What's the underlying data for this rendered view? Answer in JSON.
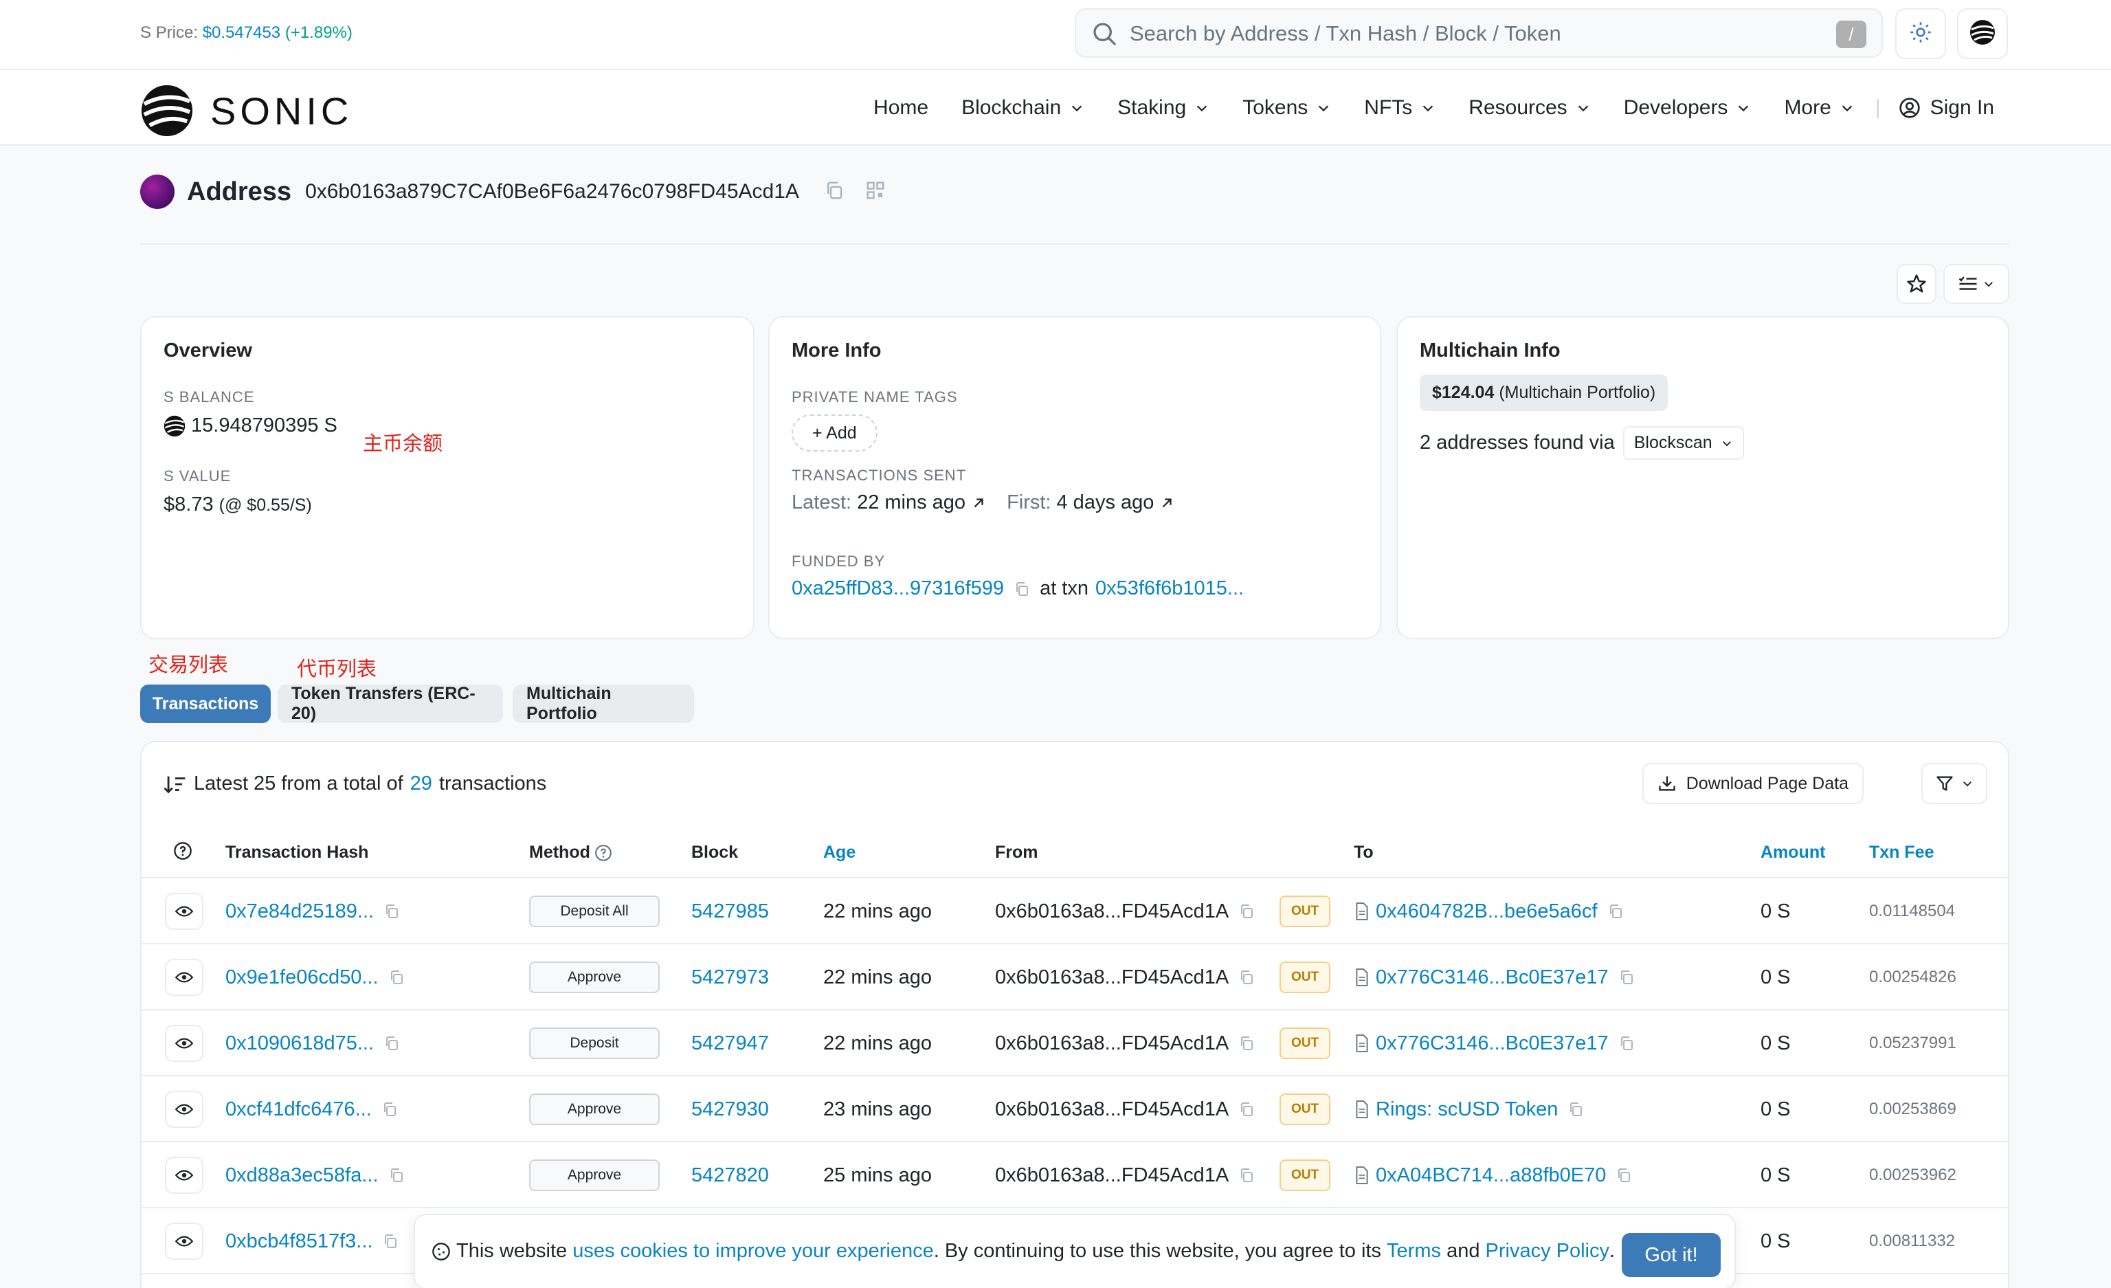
{
  "topbar": {
    "price_label": "S Price:",
    "price_value": "$0.547453",
    "price_change": "(+1.89%)",
    "search_placeholder": "Search by Address / Txn Hash / Block / Token",
    "search_shortcut": "/"
  },
  "nav": {
    "logo_text": "SONIC",
    "items": [
      "Home",
      "Blockchain",
      "Staking",
      "Tokens",
      "NFTs",
      "Resources",
      "Developers",
      "More"
    ],
    "sign_in": "Sign In"
  },
  "header": {
    "title": "Address",
    "address": "0x6b0163a879C7CAf0Be6F6a2476c0798FD45Acd1A"
  },
  "overview": {
    "title": "Overview",
    "balance_label": "S BALANCE",
    "balance_value": "15.948790395 S",
    "value_label": "S VALUE",
    "value_amount": "$8.73",
    "value_rate": "(@ $0.55/S)",
    "annotation": "主币余额"
  },
  "more_info": {
    "title": "More Info",
    "tags_label": "PRIVATE NAME TAGS",
    "add_label": "+ Add",
    "sent_label": "TRANSACTIONS SENT",
    "latest_label": "Latest:",
    "latest_value": "22 mins ago",
    "first_label": "First:",
    "first_value": "4 days ago",
    "funded_label": "FUNDED BY",
    "funded_address": "0xa25ffD83...97316f599",
    "at_txn": "at txn",
    "funded_txn": "0x53f6f6b1015..."
  },
  "multichain": {
    "title": "Multichain Info",
    "portfolio_value": "$124.04",
    "portfolio_label": "(Multichain Portfolio)",
    "found_text": "2 addresses found via",
    "found_source": "Blockscan"
  },
  "annotations": {
    "tx_list": "交易列表",
    "token_list": "代币列表"
  },
  "tabs": [
    "Transactions",
    "Token Transfers (ERC-20)",
    "Multichain Portfolio"
  ],
  "tx": {
    "summary_pre": "Latest 25 from a total of",
    "summary_count": "29",
    "summary_post": "transactions",
    "download": "Download Page Data",
    "columns": [
      "Transaction Hash",
      "Method",
      "Block",
      "Age",
      "From",
      "To",
      "Amount",
      "Txn Fee"
    ],
    "rows": [
      {
        "hash": "0x7e84d25189...",
        "method": "Deposit All",
        "block": "5427985",
        "age": "22 mins ago",
        "from": "0x6b0163a8...FD45Acd1A",
        "dir": "OUT",
        "to": "0x4604782B...be6e5a6cf",
        "amount": "0 S",
        "fee": "0.01148504"
      },
      {
        "hash": "0x9e1fe06cd50...",
        "method": "Approve",
        "block": "5427973",
        "age": "22 mins ago",
        "from": "0x6b0163a8...FD45Acd1A",
        "dir": "OUT",
        "to": "0x776C3146...Bc0E37e17",
        "amount": "0 S",
        "fee": "0.00254826"
      },
      {
        "hash": "0x1090618d75...",
        "method": "Deposit",
        "block": "5427947",
        "age": "22 mins ago",
        "from": "0x6b0163a8...FD45Acd1A",
        "dir": "OUT",
        "to": "0x776C3146...Bc0E37e17",
        "amount": "0 S",
        "fee": "0.05237991"
      },
      {
        "hash": "0xcf41dfc6476...",
        "method": "Approve",
        "block": "5427930",
        "age": "23 mins ago",
        "from": "0x6b0163a8...FD45Acd1A",
        "dir": "OUT",
        "to": "Rings: scUSD Token",
        "amount": "0 S",
        "fee": "0.00253869"
      },
      {
        "hash": "0xd88a3ec58fa...",
        "method": "Approve",
        "block": "5427820",
        "age": "25 mins ago",
        "from": "0x6b0163a8...FD45Acd1A",
        "dir": "OUT",
        "to": "0xA04BC714...a88fb0E70",
        "amount": "0 S",
        "fee": "0.00253962"
      },
      {
        "hash": "0xbcb4f8517f3...",
        "amount": "0 S",
        "fee": "0.00811332"
      }
    ]
  },
  "cookie": {
    "pre": "This website",
    "link1": "uses cookies to improve your experience",
    "mid": ". By continuing to use this website, you agree to its",
    "terms": "Terms",
    "and": "and",
    "privacy": "Privacy Policy",
    "end": ".",
    "button": "Got it!"
  }
}
